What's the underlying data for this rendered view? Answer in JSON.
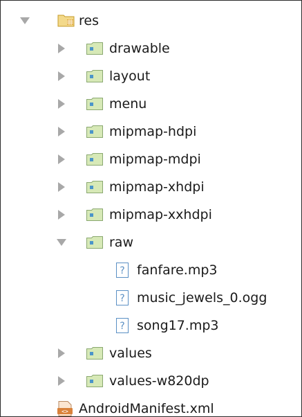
{
  "tree": {
    "root": {
      "label": "res",
      "expanded": true,
      "icon": "resource-folder-icon"
    },
    "folders": [
      {
        "label": "drawable",
        "expanded": false
      },
      {
        "label": "layout",
        "expanded": false
      },
      {
        "label": "menu",
        "expanded": false
      },
      {
        "label": "mipmap-hdpi",
        "expanded": false
      },
      {
        "label": "mipmap-mdpi",
        "expanded": false
      },
      {
        "label": "mipmap-xhdpi",
        "expanded": false
      },
      {
        "label": "mipmap-xxhdpi",
        "expanded": false
      },
      {
        "label": "raw",
        "expanded": true
      }
    ],
    "raw_files": [
      {
        "label": "fanfare.mp3",
        "icon": "unknown-file-icon"
      },
      {
        "label": "music_jewels_0.ogg",
        "icon": "unknown-file-icon"
      },
      {
        "label": "song17.mp3",
        "icon": "unknown-file-icon"
      }
    ],
    "folders_after": [
      {
        "label": "values",
        "expanded": false
      },
      {
        "label": "values-w820dp",
        "expanded": false
      }
    ],
    "manifest": {
      "label": "AndroidManifest.xml",
      "icon": "android-manifest-icon"
    }
  },
  "colors": {
    "folder_fill": "#d7e9b7",
    "folder_border": "#8aa870",
    "folder_badge": "#4b95c9",
    "root_folder": "#e8c25a",
    "arrow": "#a8a8a8",
    "file_icon": "#5a8fc4",
    "manifest_icon": "#d9823b"
  }
}
